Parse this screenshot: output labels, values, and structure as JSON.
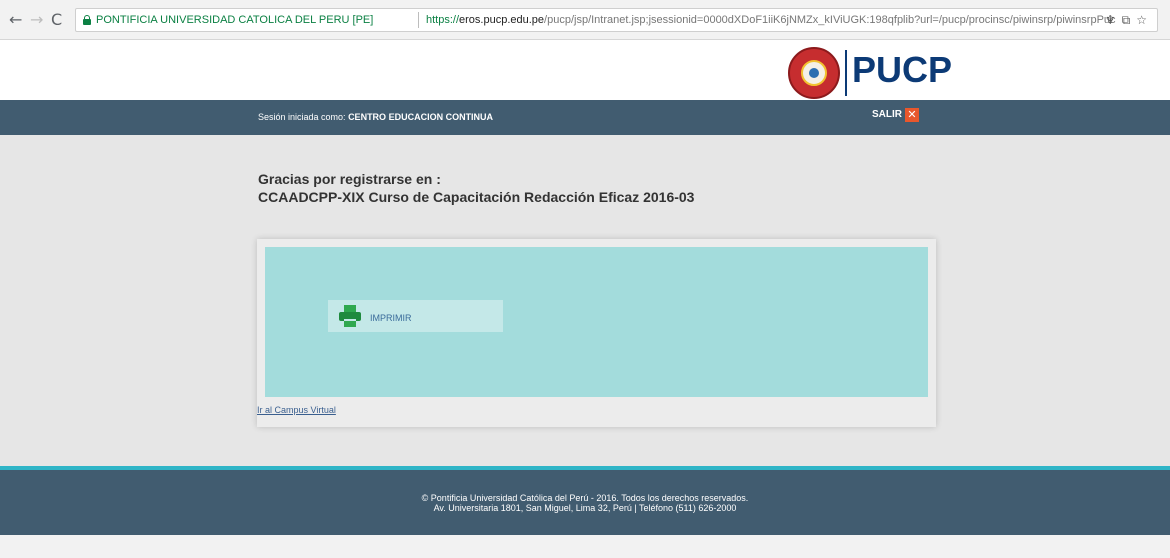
{
  "browser": {
    "back": "←",
    "forward": "→",
    "reload": "C",
    "site_identity": "PONTIFICIA UNIVERSIDAD CATOLICA DEL PERU [PE]",
    "url_scheme": "https://",
    "url_domain": "eros.pucp.edu.pe",
    "url_path": "/pucp/jsp/Intranet.jsp;jsessionid=0000dXDoF1iiK6jNMZx_kIViUGK:198qfplib?url=/pucp/procinsc/piwinsrp/piwinsrpPucpQuestionaccion=CrearI",
    "ext_icons": [
      "♆",
      "⧉",
      "☆"
    ]
  },
  "header": {
    "logo_text": "PUCP"
  },
  "session": {
    "prefix": "Sesión iniciada como: ",
    "user": "CENTRO EDUCACION CONTINUA",
    "logout_label": "SALIR",
    "logout_icon": "✕"
  },
  "main": {
    "thanks_line1": "Gracias por registrarse en :",
    "thanks_line2": "CCAADCPP-XIX Curso de Capacitación Redacción Eficaz 2016-03",
    "print_label": "IMPRIMIR",
    "campus_link": "Ir al Campus Virtual"
  },
  "footer": {
    "line1": "© Pontificia Universidad Católica del Perú - 2016. Todos los derechos reservados.",
    "line2": "Av. Universitaria 1801, San Miguel, Lima 32, Perú | Teléfono (511) 626-2000"
  },
  "colors": {
    "session_bar": "#415c70",
    "accent_teal": "#2fb5c7",
    "panel": "#a3dcdc",
    "logo_blue": "#0c3a76",
    "logout_orange": "#e8572c"
  }
}
